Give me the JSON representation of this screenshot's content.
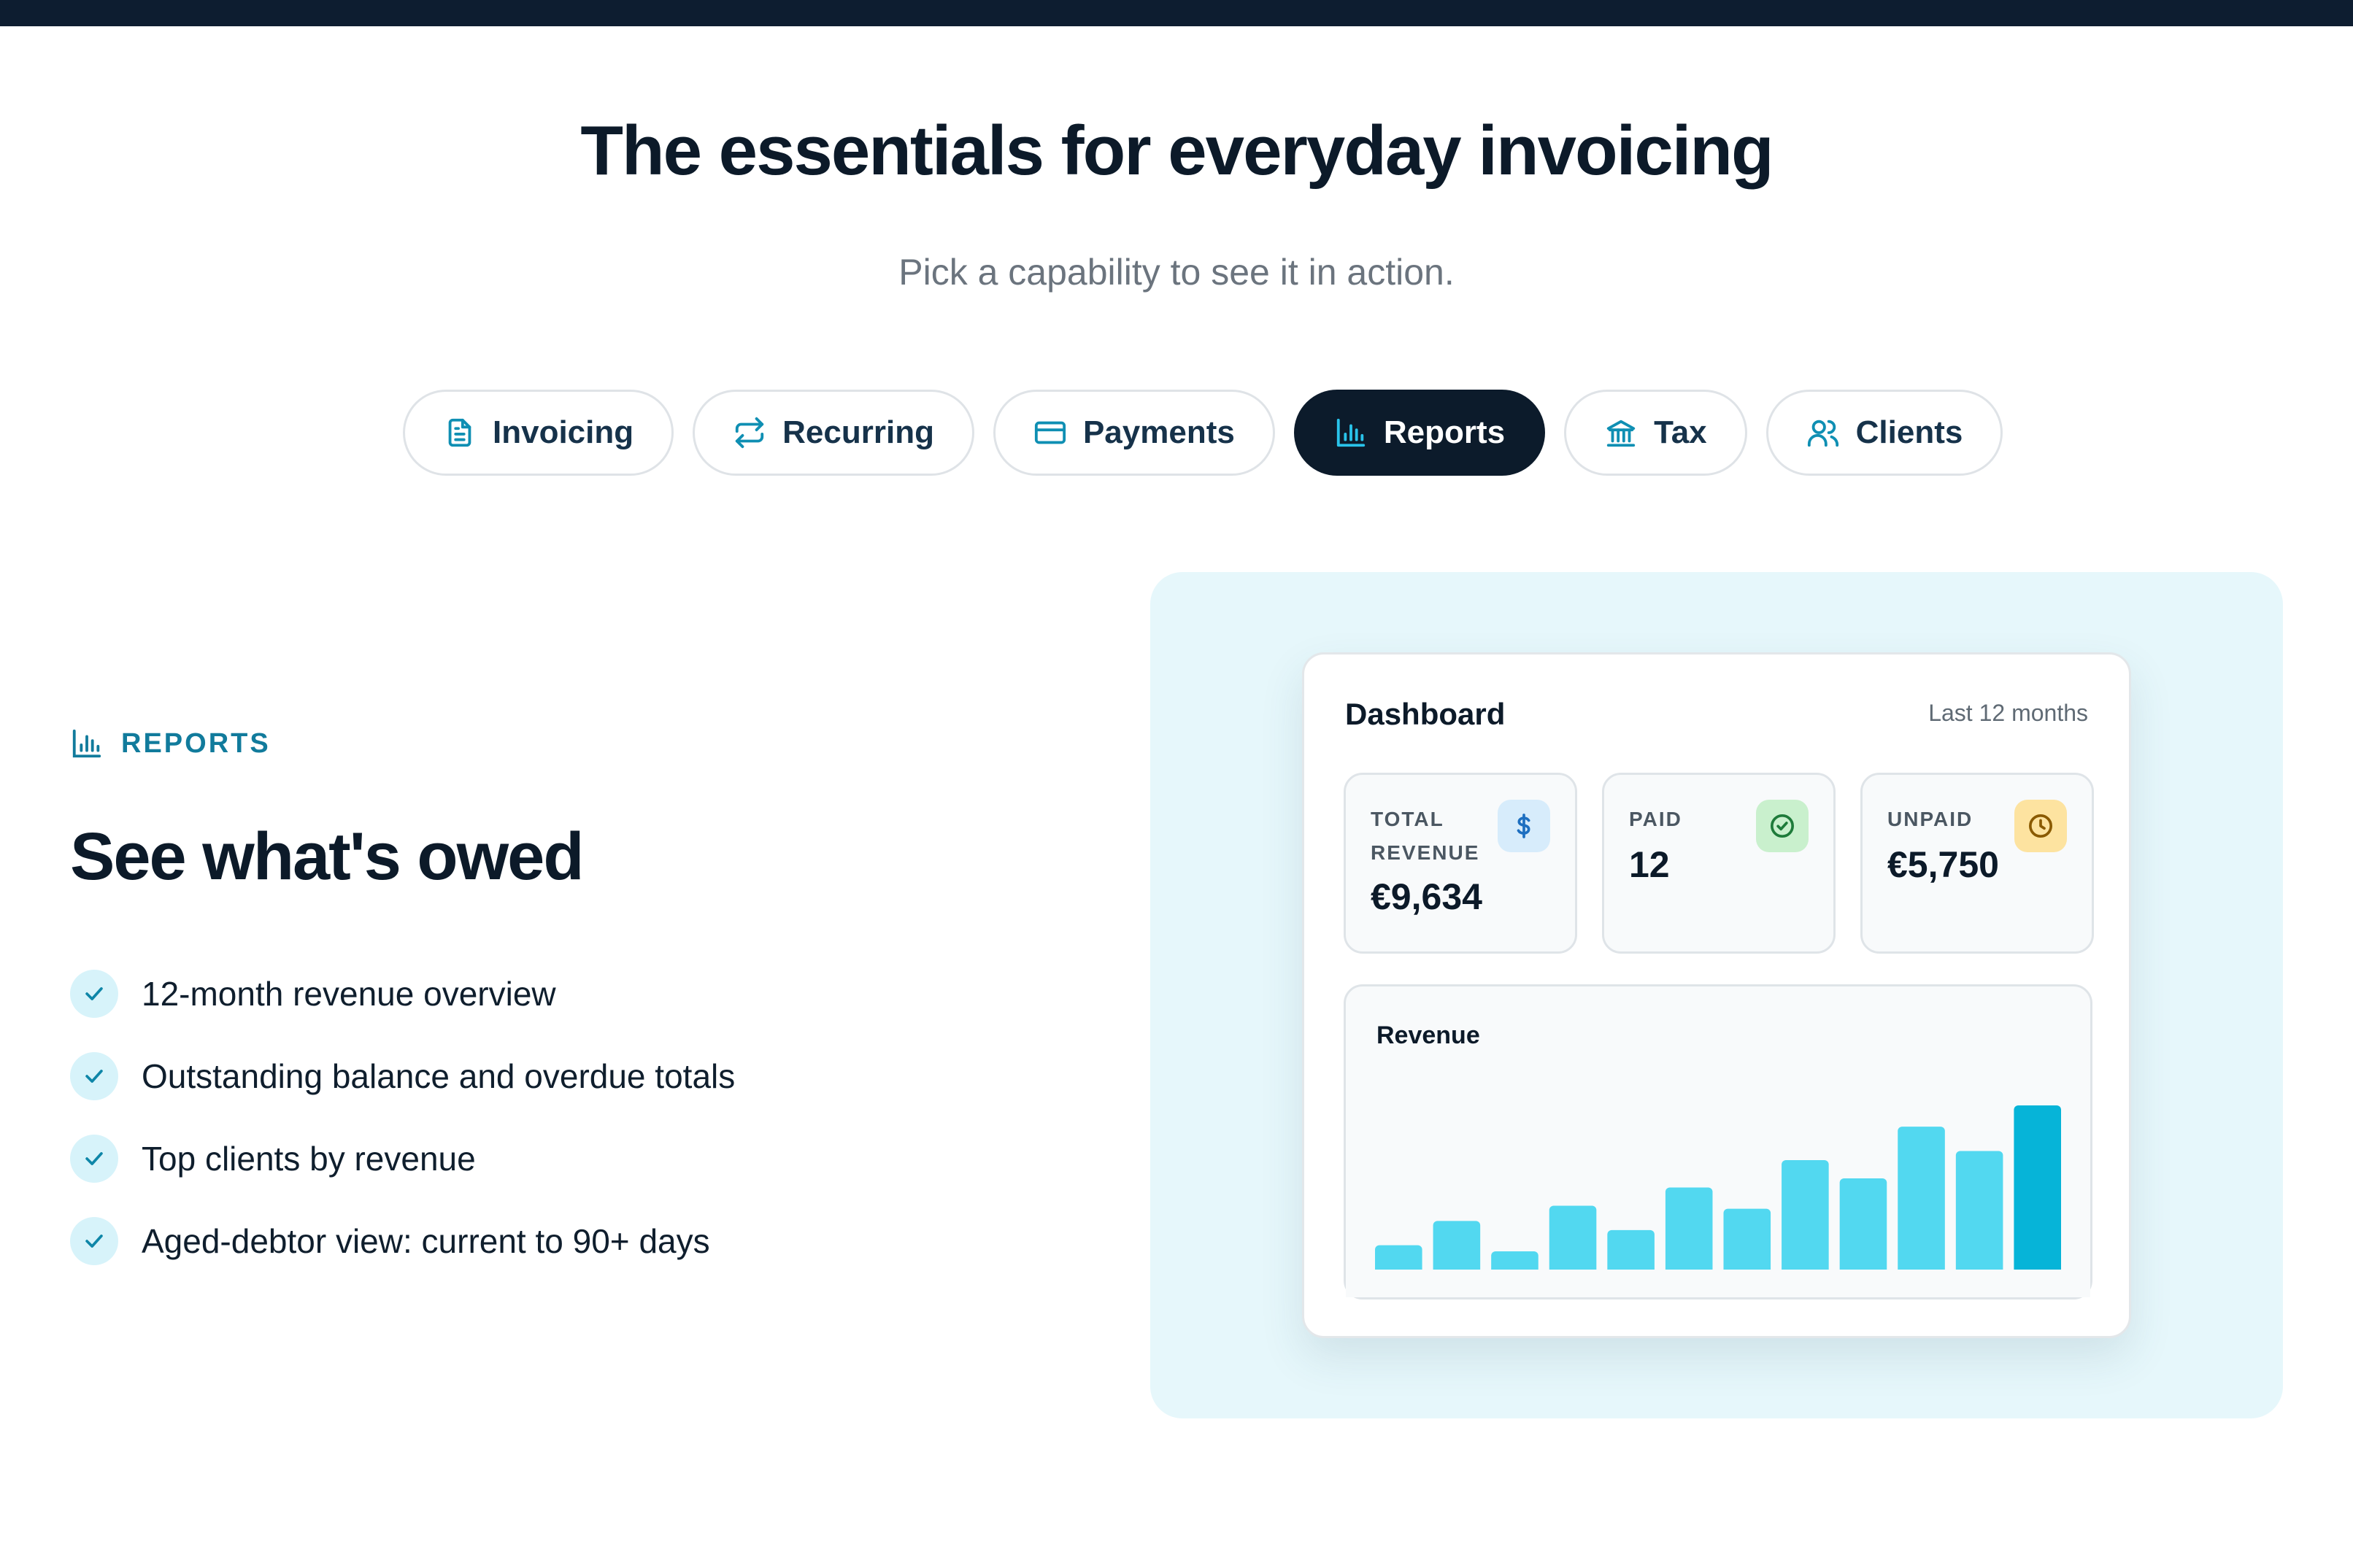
{
  "hero": {
    "title": "The essentials for everyday invoicing",
    "subtitle": "Pick a capability to see it in action."
  },
  "tabs": [
    {
      "label": "Invoicing",
      "icon": "document-icon",
      "active": false
    },
    {
      "label": "Recurring",
      "icon": "repeat-icon",
      "active": false
    },
    {
      "label": "Payments",
      "icon": "credit-card-icon",
      "active": false
    },
    {
      "label": "Reports",
      "icon": "bar-chart-icon",
      "active": true
    },
    {
      "label": "Tax",
      "icon": "bank-icon",
      "active": false
    },
    {
      "label": "Clients",
      "icon": "users-icon",
      "active": false
    }
  ],
  "section": {
    "eyebrow": "REPORTS",
    "title": "See what's owed",
    "features": [
      "12-month revenue overview",
      "Outstanding balance and overdue totals",
      "Top clients by revenue",
      "Aged-debtor view: current to 90+ days"
    ]
  },
  "dashboard": {
    "title": "Dashboard",
    "range": "Last 12 months",
    "kpis": [
      {
        "label": "TOTAL REVENUE",
        "value": "€9,634",
        "icon": "dollar-icon",
        "icon_color": "#1d6fc0",
        "icon_bg": "#d7ecfb"
      },
      {
        "label": "PAID",
        "value": "12",
        "icon": "check-circle-icon",
        "icon_color": "#1e7b3a",
        "icon_bg": "#c9f0cd"
      },
      {
        "label": "UNPAID",
        "value": "€5,750",
        "icon": "clock-icon",
        "icon_color": "#8a5a00",
        "icon_bg": "#fde3a0"
      }
    ]
  },
  "chart_data": {
    "type": "bar",
    "title": "Revenue",
    "categories": [],
    "values": [
      8,
      16,
      6,
      21,
      13,
      27,
      20,
      36,
      30,
      47,
      39,
      54
    ],
    "ylim": [
      0,
      60
    ],
    "grid": false,
    "colors": {
      "bar": "#52d8f0",
      "highlight": "#06b4d8"
    }
  }
}
